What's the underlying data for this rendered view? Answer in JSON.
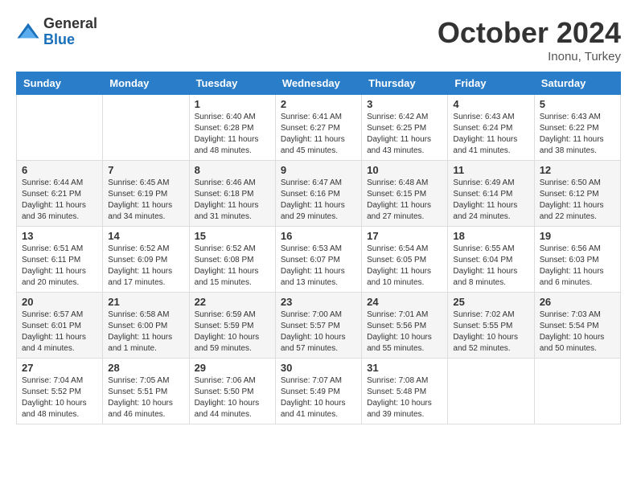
{
  "logo": {
    "general": "General",
    "blue": "Blue"
  },
  "title": "October 2024",
  "location": "Inonu, Turkey",
  "days_of_week": [
    "Sunday",
    "Monday",
    "Tuesday",
    "Wednesday",
    "Thursday",
    "Friday",
    "Saturday"
  ],
  "weeks": [
    [
      {
        "day": "",
        "info": ""
      },
      {
        "day": "",
        "info": ""
      },
      {
        "day": "1",
        "info": "Sunrise: 6:40 AM\nSunset: 6:28 PM\nDaylight: 11 hours and 48 minutes."
      },
      {
        "day": "2",
        "info": "Sunrise: 6:41 AM\nSunset: 6:27 PM\nDaylight: 11 hours and 45 minutes."
      },
      {
        "day": "3",
        "info": "Sunrise: 6:42 AM\nSunset: 6:25 PM\nDaylight: 11 hours and 43 minutes."
      },
      {
        "day": "4",
        "info": "Sunrise: 6:43 AM\nSunset: 6:24 PM\nDaylight: 11 hours and 41 minutes."
      },
      {
        "day": "5",
        "info": "Sunrise: 6:43 AM\nSunset: 6:22 PM\nDaylight: 11 hours and 38 minutes."
      }
    ],
    [
      {
        "day": "6",
        "info": "Sunrise: 6:44 AM\nSunset: 6:21 PM\nDaylight: 11 hours and 36 minutes."
      },
      {
        "day": "7",
        "info": "Sunrise: 6:45 AM\nSunset: 6:19 PM\nDaylight: 11 hours and 34 minutes."
      },
      {
        "day": "8",
        "info": "Sunrise: 6:46 AM\nSunset: 6:18 PM\nDaylight: 11 hours and 31 minutes."
      },
      {
        "day": "9",
        "info": "Sunrise: 6:47 AM\nSunset: 6:16 PM\nDaylight: 11 hours and 29 minutes."
      },
      {
        "day": "10",
        "info": "Sunrise: 6:48 AM\nSunset: 6:15 PM\nDaylight: 11 hours and 27 minutes."
      },
      {
        "day": "11",
        "info": "Sunrise: 6:49 AM\nSunset: 6:14 PM\nDaylight: 11 hours and 24 minutes."
      },
      {
        "day": "12",
        "info": "Sunrise: 6:50 AM\nSunset: 6:12 PM\nDaylight: 11 hours and 22 minutes."
      }
    ],
    [
      {
        "day": "13",
        "info": "Sunrise: 6:51 AM\nSunset: 6:11 PM\nDaylight: 11 hours and 20 minutes."
      },
      {
        "day": "14",
        "info": "Sunrise: 6:52 AM\nSunset: 6:09 PM\nDaylight: 11 hours and 17 minutes."
      },
      {
        "day": "15",
        "info": "Sunrise: 6:52 AM\nSunset: 6:08 PM\nDaylight: 11 hours and 15 minutes."
      },
      {
        "day": "16",
        "info": "Sunrise: 6:53 AM\nSunset: 6:07 PM\nDaylight: 11 hours and 13 minutes."
      },
      {
        "day": "17",
        "info": "Sunrise: 6:54 AM\nSunset: 6:05 PM\nDaylight: 11 hours and 10 minutes."
      },
      {
        "day": "18",
        "info": "Sunrise: 6:55 AM\nSunset: 6:04 PM\nDaylight: 11 hours and 8 minutes."
      },
      {
        "day": "19",
        "info": "Sunrise: 6:56 AM\nSunset: 6:03 PM\nDaylight: 11 hours and 6 minutes."
      }
    ],
    [
      {
        "day": "20",
        "info": "Sunrise: 6:57 AM\nSunset: 6:01 PM\nDaylight: 11 hours and 4 minutes."
      },
      {
        "day": "21",
        "info": "Sunrise: 6:58 AM\nSunset: 6:00 PM\nDaylight: 11 hours and 1 minute."
      },
      {
        "day": "22",
        "info": "Sunrise: 6:59 AM\nSunset: 5:59 PM\nDaylight: 10 hours and 59 minutes."
      },
      {
        "day": "23",
        "info": "Sunrise: 7:00 AM\nSunset: 5:57 PM\nDaylight: 10 hours and 57 minutes."
      },
      {
        "day": "24",
        "info": "Sunrise: 7:01 AM\nSunset: 5:56 PM\nDaylight: 10 hours and 55 minutes."
      },
      {
        "day": "25",
        "info": "Sunrise: 7:02 AM\nSunset: 5:55 PM\nDaylight: 10 hours and 52 minutes."
      },
      {
        "day": "26",
        "info": "Sunrise: 7:03 AM\nSunset: 5:54 PM\nDaylight: 10 hours and 50 minutes."
      }
    ],
    [
      {
        "day": "27",
        "info": "Sunrise: 7:04 AM\nSunset: 5:52 PM\nDaylight: 10 hours and 48 minutes."
      },
      {
        "day": "28",
        "info": "Sunrise: 7:05 AM\nSunset: 5:51 PM\nDaylight: 10 hours and 46 minutes."
      },
      {
        "day": "29",
        "info": "Sunrise: 7:06 AM\nSunset: 5:50 PM\nDaylight: 10 hours and 44 minutes."
      },
      {
        "day": "30",
        "info": "Sunrise: 7:07 AM\nSunset: 5:49 PM\nDaylight: 10 hours and 41 minutes."
      },
      {
        "day": "31",
        "info": "Sunrise: 7:08 AM\nSunset: 5:48 PM\nDaylight: 10 hours and 39 minutes."
      },
      {
        "day": "",
        "info": ""
      },
      {
        "day": "",
        "info": ""
      }
    ]
  ]
}
